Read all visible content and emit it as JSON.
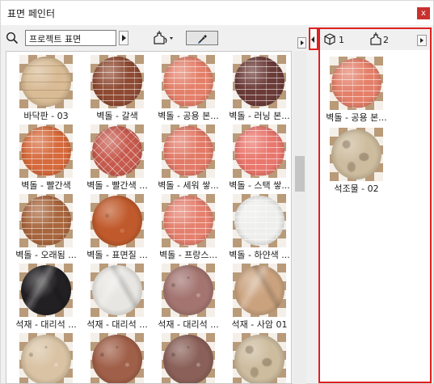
{
  "window": {
    "title": "표면 페인터",
    "close_label": "x",
    "close_color": "#c8312e"
  },
  "toolbar": {
    "search_icon": "magnifier-icon",
    "search_value": "프로젝트 표면",
    "bucket_icon": "paint-bucket-icon",
    "eyedropper_icon": "eyedropper-icon"
  },
  "materials": [
    {
      "label": "바닥판 - 03",
      "color": "#d9bc96",
      "pattern": "plank"
    },
    {
      "label": "벽돌 - 갈색",
      "color": "#8e4a32",
      "pattern": "brick"
    },
    {
      "label": "벽돌 - 공용 본...",
      "color": "#e4806a",
      "pattern": "brick"
    },
    {
      "label": "벽돌 - 러닝 본...",
      "color": "#6b3b38",
      "pattern": "brick"
    },
    {
      "label": "벽돌 - 빨간색",
      "color": "#d66a3c",
      "pattern": "brick"
    },
    {
      "label": "벽돌 - 빨간색 ...",
      "color": "#c65a4d",
      "pattern": "herringbone"
    },
    {
      "label": "벽돌 - 세워 쌓...",
      "color": "#e27a67",
      "pattern": "brick"
    },
    {
      "label": "벽돌 - 스택 쌓...",
      "color": "#e9776d",
      "pattern": "brick"
    },
    {
      "label": "벽돌 - 오래됨 ...",
      "color": "#a8663d",
      "pattern": "brick"
    },
    {
      "label": "벽돌 - 표면질 ...",
      "color": "#c05a2c",
      "pattern": "rough"
    },
    {
      "label": "벽돌 - 프랑스...",
      "color": "#e5806e",
      "pattern": "brick"
    },
    {
      "label": "벽돌 - 하얀색 ...",
      "color": "#eeeeec",
      "pattern": "brick"
    },
    {
      "label": "석재 - 대리석 ...",
      "color": "#222022",
      "pattern": "marble"
    },
    {
      "label": "석재 - 대리석 ...",
      "color": "#e8e6e2",
      "pattern": "marble"
    },
    {
      "label": "석재 - 대리석 ...",
      "color": "#a37470",
      "pattern": "granite"
    },
    {
      "label": "석재 - 사암 01",
      "color": "#caa27e",
      "pattern": "marble"
    },
    {
      "label": "",
      "color": "#d9c3a4",
      "pattern": "granite"
    },
    {
      "label": "",
      "color": "#a05f48",
      "pattern": "granite"
    },
    {
      "label": "",
      "color": "#8a6058",
      "pattern": "granite"
    },
    {
      "label": "",
      "color": "#cdbc9e",
      "pattern": "stone"
    }
  ],
  "right_panel": {
    "cube_icon": "cube-icon",
    "count_cube": "1",
    "bucket_icon": "paint-bucket-icon",
    "count_bucket": "2",
    "items": [
      {
        "label": "벽돌 - 공용 본...",
        "color": "#e4806a",
        "pattern": "brick"
      },
      {
        "label": "석조물 - 02",
        "color": "#cdbc9e",
        "pattern": "stone"
      }
    ],
    "highlight_color": "#e02020"
  }
}
